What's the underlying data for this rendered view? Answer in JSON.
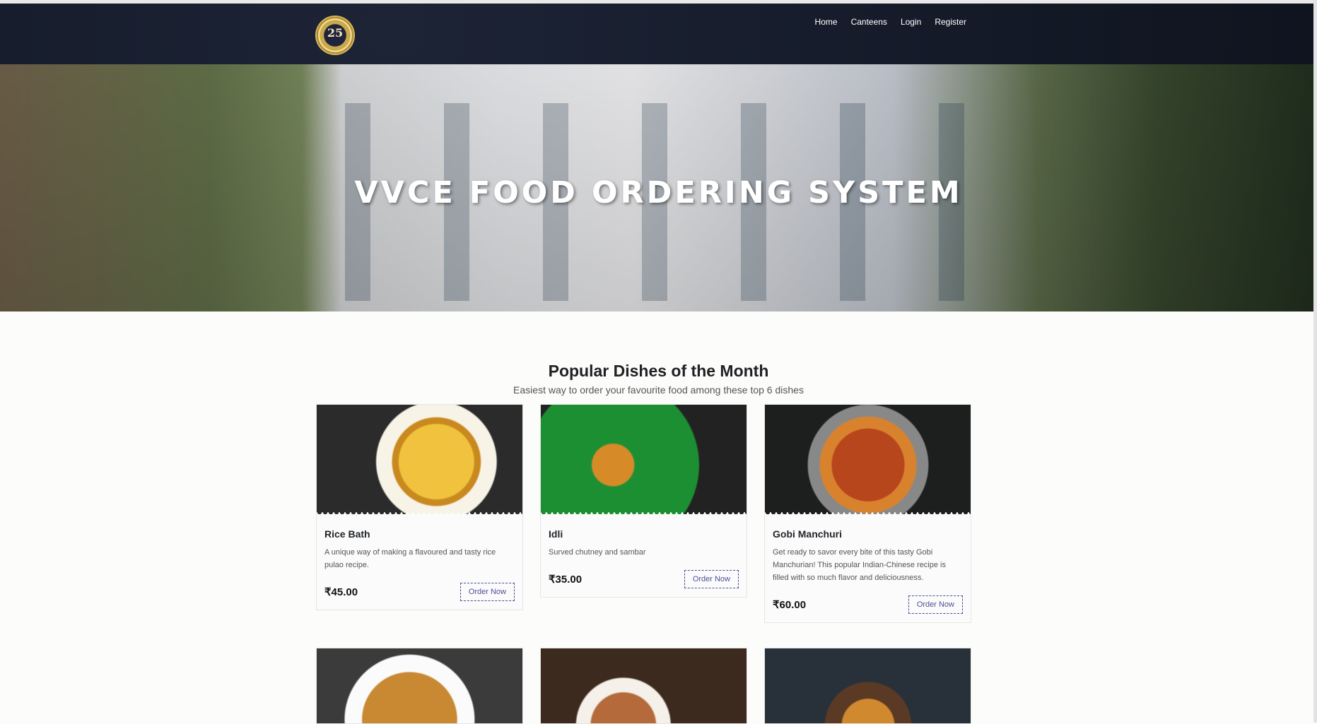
{
  "navbar": {
    "logo_mark": "25",
    "links": [
      "Home",
      "Canteens",
      "Login",
      "Register"
    ]
  },
  "hero": {
    "title": "VVCE FOOD ORDERING SYSTEM"
  },
  "popular": {
    "title": "Popular Dishes of the Month",
    "subtitle": "Easiest way to order your favourite food among these top 6 dishes",
    "button_label": "Order Now",
    "items": [
      {
        "name": "Rice Bath",
        "description": "A unique way of making a flavoured and tasty rice pulao recipe.",
        "price": "₹45.00"
      },
      {
        "name": "Idli",
        "description": "Surved chutney and sambar",
        "price": "₹35.00"
      },
      {
        "name": "Gobi Manchuri",
        "description": "Get ready to savor every bite of this tasty Gobi Manchurian! This popular Indian-Chinese recipe is filled with so much flavor and deliciousness.",
        "price": "₹60.00"
      }
    ]
  },
  "colors": {
    "navbar_bg": "#141a28",
    "button_accent": "#4d4f96"
  }
}
